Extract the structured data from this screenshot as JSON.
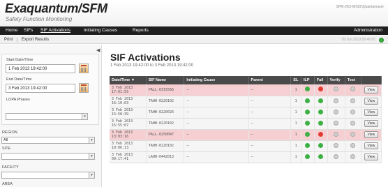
{
  "header": {
    "title": "Exaquantum/SFM",
    "subtitle": "Safety Function Monitoring",
    "user_info": "SPM-2K3-WS02\\Quantumuser"
  },
  "nav": {
    "items": [
      "Home",
      "SIFs",
      "SIF Activations",
      "Initiating Causes",
      "Reports"
    ],
    "admin": "Administration"
  },
  "toolbar": {
    "print": "Print",
    "export": "Export Results",
    "datetime": "05 Jun 2013 09:46:00"
  },
  "sidebar": {
    "start_label": "Start Date/Time",
    "start_value": "1 Feb 2013 19:42:00",
    "end_label": "End Date/Time",
    "end_value": "3 Feb 2013 19:42:00",
    "lopa_label": "LOPA Phases",
    "region_label": "REGION",
    "region_value": "All",
    "site_label": "SITE",
    "facility_label": "FACILITY",
    "area_label": "AREA"
  },
  "main": {
    "title": "SIF Activations",
    "subtitle": "1 Feb 2013 19:42:00 to 3 Feb 2013 19:42:00"
  },
  "table": {
    "headers": [
      "Date/Time ▼",
      "SIF Name",
      "Initiating Cause",
      "Parent",
      "SL",
      "ILP",
      "Fail",
      "Verify",
      "Test",
      ""
    ],
    "rows": [
      {
        "date": "3 Feb 2013 17:01:55",
        "sif": "PALL-0315566",
        "cause": "--",
        "parent": "--",
        "sl": "1",
        "ilp": "green",
        "fail": "red",
        "verify": "grey",
        "test": "grey",
        "view": "View",
        "alarm": true
      },
      {
        "date": "3 Feb 2013 16:10:03",
        "sif": "TAHH-0220102",
        "cause": "--",
        "parent": "--",
        "sl": "1",
        "ilp": "green",
        "fail": "green",
        "verify": "grey",
        "test": "grey",
        "view": "View",
        "alarm": false
      },
      {
        "date": "3 Feb 2013 15:58:39",
        "sif": "TAHH-0220026",
        "cause": "--",
        "parent": "--",
        "sl": "1",
        "ilp": "green",
        "fail": "green",
        "verify": "grey",
        "test": "grey",
        "view": "View",
        "alarm": false
      },
      {
        "date": "3 Feb 2013 15:55:07",
        "sif": "TAHH-0220102",
        "cause": "--",
        "parent": "--",
        "sl": "1",
        "ilp": "green",
        "fail": "green",
        "verify": "grey",
        "test": "grey",
        "view": "View",
        "alarm": false
      },
      {
        "date": "3 Feb 2013 13:03:16",
        "sif": "PALL-0250047",
        "cause": "--",
        "parent": "--",
        "sl": "1",
        "ilp": "green",
        "fail": "red",
        "verify": "grey",
        "test": "grey",
        "view": "View",
        "alarm": true
      },
      {
        "date": "3 Feb 2013 10:06:13",
        "sif": "TAHH-0220102",
        "cause": "--",
        "parent": "--",
        "sl": "1",
        "ilp": "green",
        "fail": "green",
        "verify": "grey",
        "test": "grey",
        "view": "View",
        "alarm": false
      },
      {
        "date": "3 Feb 2013 09:17:41",
        "sif": "LAHH-0442013",
        "cause": "--",
        "parent": "--",
        "sl": "1",
        "ilp": "green",
        "fail": "green",
        "verify": "grey",
        "test": "grey",
        "view": "View",
        "alarm": false
      }
    ]
  }
}
